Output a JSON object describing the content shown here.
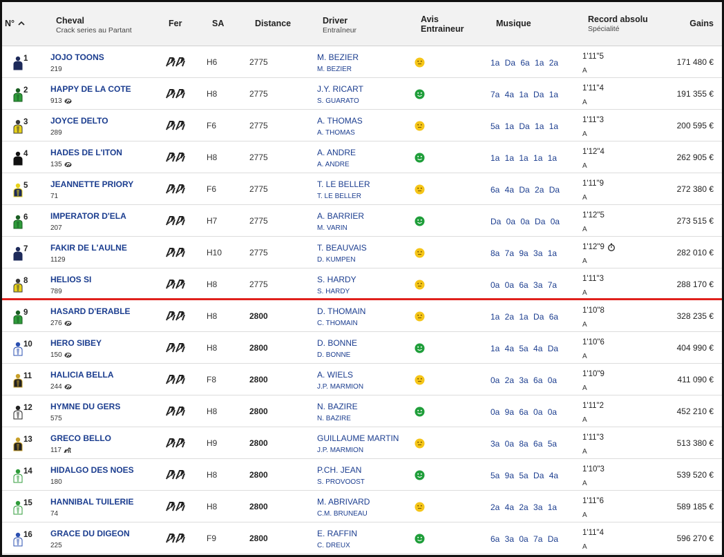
{
  "header": {
    "num_label": "N°",
    "cheval_label": "Cheval",
    "cheval_sub": "Crack series au Partant",
    "fer_label": "Fer",
    "sa_label": "SA",
    "distance_label": "Distance",
    "driver_label": "Driver",
    "driver_sub": "Entraîneur",
    "avis_label_1": "Avis",
    "avis_label_2": "Entraineur",
    "musique_label": "Musique",
    "record_label": "Record absolu",
    "record_sub": "Spécialité",
    "gains_label": "Gains"
  },
  "colors": {
    "link": "#1b3d8f",
    "separator": "#e0201c",
    "avis_yellow": "#f5c518",
    "avis_green": "#1f9e3a"
  },
  "rows": [
    {
      "num": "1",
      "name": "JOJO TOONS",
      "sub": "219",
      "sub_icon": "",
      "sa": "H6",
      "distance": "2775",
      "driver": "M. BEZIER",
      "trainer": "M. BEZIER",
      "avis": "yellow",
      "musique": "1a Da 6a 1a 2a",
      "record": "1'11\"5",
      "record_icon": "",
      "specialite": "A",
      "gains": "171 480 €",
      "silk": "navy"
    },
    {
      "num": "2",
      "name": "HAPPY DE LA COTE",
      "sub": "913",
      "sub_icon": "link-icon",
      "sa": "H8",
      "distance": "2775",
      "driver": "J.Y. RICART",
      "trainer": "S. GUARATO",
      "avis": "green",
      "musique": "7a 4a 1a Da 1a",
      "record": "1'11\"4",
      "record_icon": "",
      "specialite": "A",
      "gains": "191 355 €",
      "silk": "green"
    },
    {
      "num": "3",
      "name": "JOYCE DELTO",
      "sub": "289",
      "sub_icon": "",
      "sa": "F6",
      "distance": "2775",
      "driver": "A. THOMAS",
      "trainer": "A. THOMAS",
      "avis": "yellow",
      "musique": "5a 1a Da 1a 1a",
      "record": "1'11\"3",
      "record_icon": "",
      "specialite": "A",
      "gains": "200 595 €",
      "silk": "yellow"
    },
    {
      "num": "4",
      "name": "HADES DE L'ITON",
      "sub": "135",
      "sub_icon": "link-icon",
      "sa": "H8",
      "distance": "2775",
      "driver": "A. ANDRE",
      "trainer": "A. ANDRE",
      "avis": "green",
      "musique": "1a 1a 1a 1a 1a",
      "record": "1'12\"4",
      "record_icon": "",
      "specialite": "A",
      "gains": "262 905 €",
      "silk": "black"
    },
    {
      "num": "5",
      "name": "JEANNETTE PRIORY",
      "sub": "71",
      "sub_icon": "",
      "sa": "F6",
      "distance": "2775",
      "driver": "T. LE BELLER",
      "trainer": "T. LE BELLER",
      "avis": "yellow",
      "musique": "6a 4a Da 2a Da",
      "record": "1'11\"9",
      "record_icon": "",
      "specialite": "A",
      "gains": "272 380 €",
      "silk": "navy-yellow"
    },
    {
      "num": "6",
      "name": "IMPERATOR D'ELA",
      "sub": "207",
      "sub_icon": "",
      "sa": "H7",
      "distance": "2775",
      "driver": "A. BARRIER",
      "trainer": "M. VARIN",
      "avis": "green",
      "musique": "Da 0a 0a Da 0a",
      "record": "1'12\"5",
      "record_icon": "",
      "specialite": "A",
      "gains": "273 515 €",
      "silk": "green"
    },
    {
      "num": "7",
      "name": "FAKIR DE L'AULNE",
      "sub": "1129",
      "sub_icon": "",
      "sa": "H10",
      "distance": "2775",
      "driver": "T. BEAUVAIS",
      "trainer": "D. KUMPEN",
      "avis": "yellow",
      "musique": "8a 7a 9a 3a 1a",
      "record": "1'12\"9",
      "record_icon": "stopwatch-icon",
      "specialite": "A",
      "gains": "282 010 €",
      "silk": "navy"
    },
    {
      "num": "8",
      "name": "HELIOS SI",
      "sub": "789",
      "sub_icon": "",
      "sa": "H8",
      "distance": "2775",
      "driver": "S. HARDY",
      "trainer": "S. HARDY",
      "avis": "yellow",
      "musique": "0a 0a 6a 3a 7a",
      "record": "1'11\"3",
      "record_icon": "",
      "specialite": "A",
      "gains": "288 170 €",
      "silk": "yellow"
    },
    {
      "num": "9",
      "name": "HASARD D'ERABLE",
      "sub": "276",
      "sub_icon": "link-icon",
      "sa": "H8",
      "distance": "2800",
      "driver": "D. THOMAIN",
      "trainer": "C. THOMAIN",
      "avis": "yellow",
      "musique": "1a 2a 1a Da 6a",
      "record": "1'10\"8",
      "record_icon": "",
      "specialite": "A",
      "gains": "328 235 €",
      "silk": "green"
    },
    {
      "num": "10",
      "name": "HERO SIBEY",
      "sub": "150",
      "sub_icon": "link-icon",
      "sa": "H8",
      "distance": "2800",
      "driver": "D. BONNE",
      "trainer": "D. BONNE",
      "avis": "green",
      "musique": "1a 4a 5a 4a Da",
      "record": "1'10\"6",
      "record_icon": "",
      "specialite": "A",
      "gains": "404 990 €",
      "silk": "blue-white"
    },
    {
      "num": "11",
      "name": "HALICIA BELLA",
      "sub": "244",
      "sub_icon": "link-icon",
      "sa": "F8",
      "distance": "2800",
      "driver": "A. WIELS",
      "trainer": "J.P. MARMION",
      "avis": "yellow",
      "musique": "0a 2a 3a 6a 0a",
      "record": "1'10\"9",
      "record_icon": "",
      "specialite": "A",
      "gains": "411 090 €",
      "silk": "black-gold"
    },
    {
      "num": "12",
      "name": "HYMNE DU GERS",
      "sub": "575",
      "sub_icon": "",
      "sa": "H8",
      "distance": "2800",
      "driver": "N. BAZIRE",
      "trainer": "N. BAZIRE",
      "avis": "green",
      "musique": "0a 9a 6a 0a 0a",
      "record": "1'11\"2",
      "record_icon": "",
      "specialite": "A",
      "gains": "452 210 €",
      "silk": "black-white"
    },
    {
      "num": "13",
      "name": "GRECO BELLO",
      "sub": "117",
      "sub_icon": "horse-icon",
      "sa": "H9",
      "distance": "2800",
      "driver": "GUILLAUME MARTIN",
      "trainer": "J.P. MARMION",
      "avis": "yellow",
      "musique": "3a 0a 8a 6a 5a",
      "record": "1'11\"3",
      "record_icon": "",
      "specialite": "A",
      "gains": "513 380 €",
      "silk": "black-gold"
    },
    {
      "num": "14",
      "name": "HIDALGO DES NOES",
      "sub": "180",
      "sub_icon": "",
      "sa": "H8",
      "distance": "2800",
      "driver": "P.CH. JEAN",
      "trainer": "S. PROVOOST",
      "avis": "green",
      "musique": "5a 9a 5a Da 4a",
      "record": "1'10\"3",
      "record_icon": "",
      "specialite": "A",
      "gains": "539 520 €",
      "silk": "white-green"
    },
    {
      "num": "15",
      "name": "HANNIBAL TUILERIE",
      "sub": "74",
      "sub_icon": "",
      "sa": "H8",
      "distance": "2800",
      "driver": "M. ABRIVARD",
      "trainer": "C.M. BRUNEAU",
      "avis": "yellow",
      "musique": "2a 4a 2a 3a 1a",
      "record": "1'11\"6",
      "record_icon": "",
      "specialite": "A",
      "gains": "589 185 €",
      "silk": "white-green"
    },
    {
      "num": "16",
      "name": "GRACE DU DIGEON",
      "sub": "225",
      "sub_icon": "",
      "sa": "F9",
      "distance": "2800",
      "driver": "E. RAFFIN",
      "trainer": "C. DREUX",
      "avis": "green",
      "musique": "6a 3a 0a 7a Da",
      "record": "1'11\"4",
      "record_icon": "",
      "specialite": "A",
      "gains": "596 270 €",
      "silk": "white-blue"
    }
  ]
}
